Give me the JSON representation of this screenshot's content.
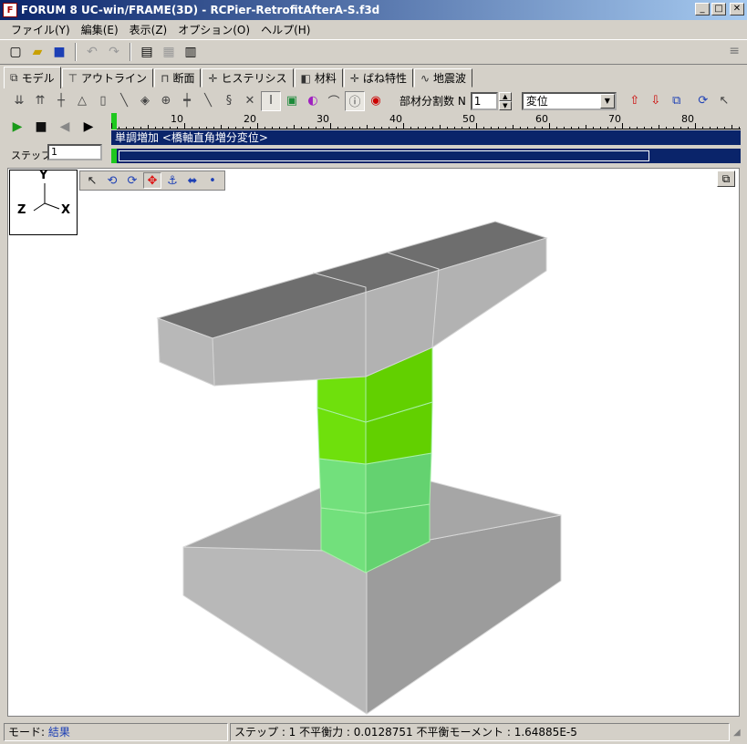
{
  "window": {
    "title": "FORUM 8  UC-win/FRAME(3D) - RCPier-RetrofitAfterA-S.f3d",
    "buttons": {
      "minimize": "_",
      "maximize": "□",
      "close": "✕"
    }
  },
  "menu": {
    "items": [
      "ファイル(Y)",
      "編集(E)",
      "表示(Z)",
      "オプション(O)",
      "ヘルプ(H)"
    ]
  },
  "tabs": [
    {
      "label": "モデル",
      "icon": "model-icon",
      "active": true
    },
    {
      "label": "アウトライン",
      "icon": "outline-icon"
    },
    {
      "label": "断面",
      "icon": "section-icon"
    },
    {
      "label": "ヒステリシス",
      "icon": "hysteresis-icon"
    },
    {
      "label": "材料",
      "icon": "material-icon"
    },
    {
      "label": "ばね特性",
      "icon": "spring-icon"
    },
    {
      "label": "地震波",
      "icon": "wave-icon"
    }
  ],
  "toolbar2": {
    "divide_label": "部材分割数 N",
    "divide_value": "1",
    "display_select": "変位"
  },
  "timeline": {
    "ruler_ticks": [
      "10",
      "20",
      "30",
      "40",
      "50",
      "60",
      "70",
      "80"
    ],
    "track_label": "単調増加 <橋軸直角増分変位>",
    "step_label": "ステップ",
    "step_value": "1"
  },
  "axis": {
    "y": "Y",
    "z": "Z",
    "x": "X"
  },
  "status": {
    "mode_label": "モード:",
    "mode_value": "結果",
    "info": "ステップ : 1 不平衡力 : 0.0128751 不平衡モーメント : 1.64885E-5"
  },
  "colors": {
    "active_green": "#6fe00c",
    "pale_green": "#72e07c",
    "concrete_gray": "#a8a8a8",
    "titlebar": "#0a246a"
  }
}
